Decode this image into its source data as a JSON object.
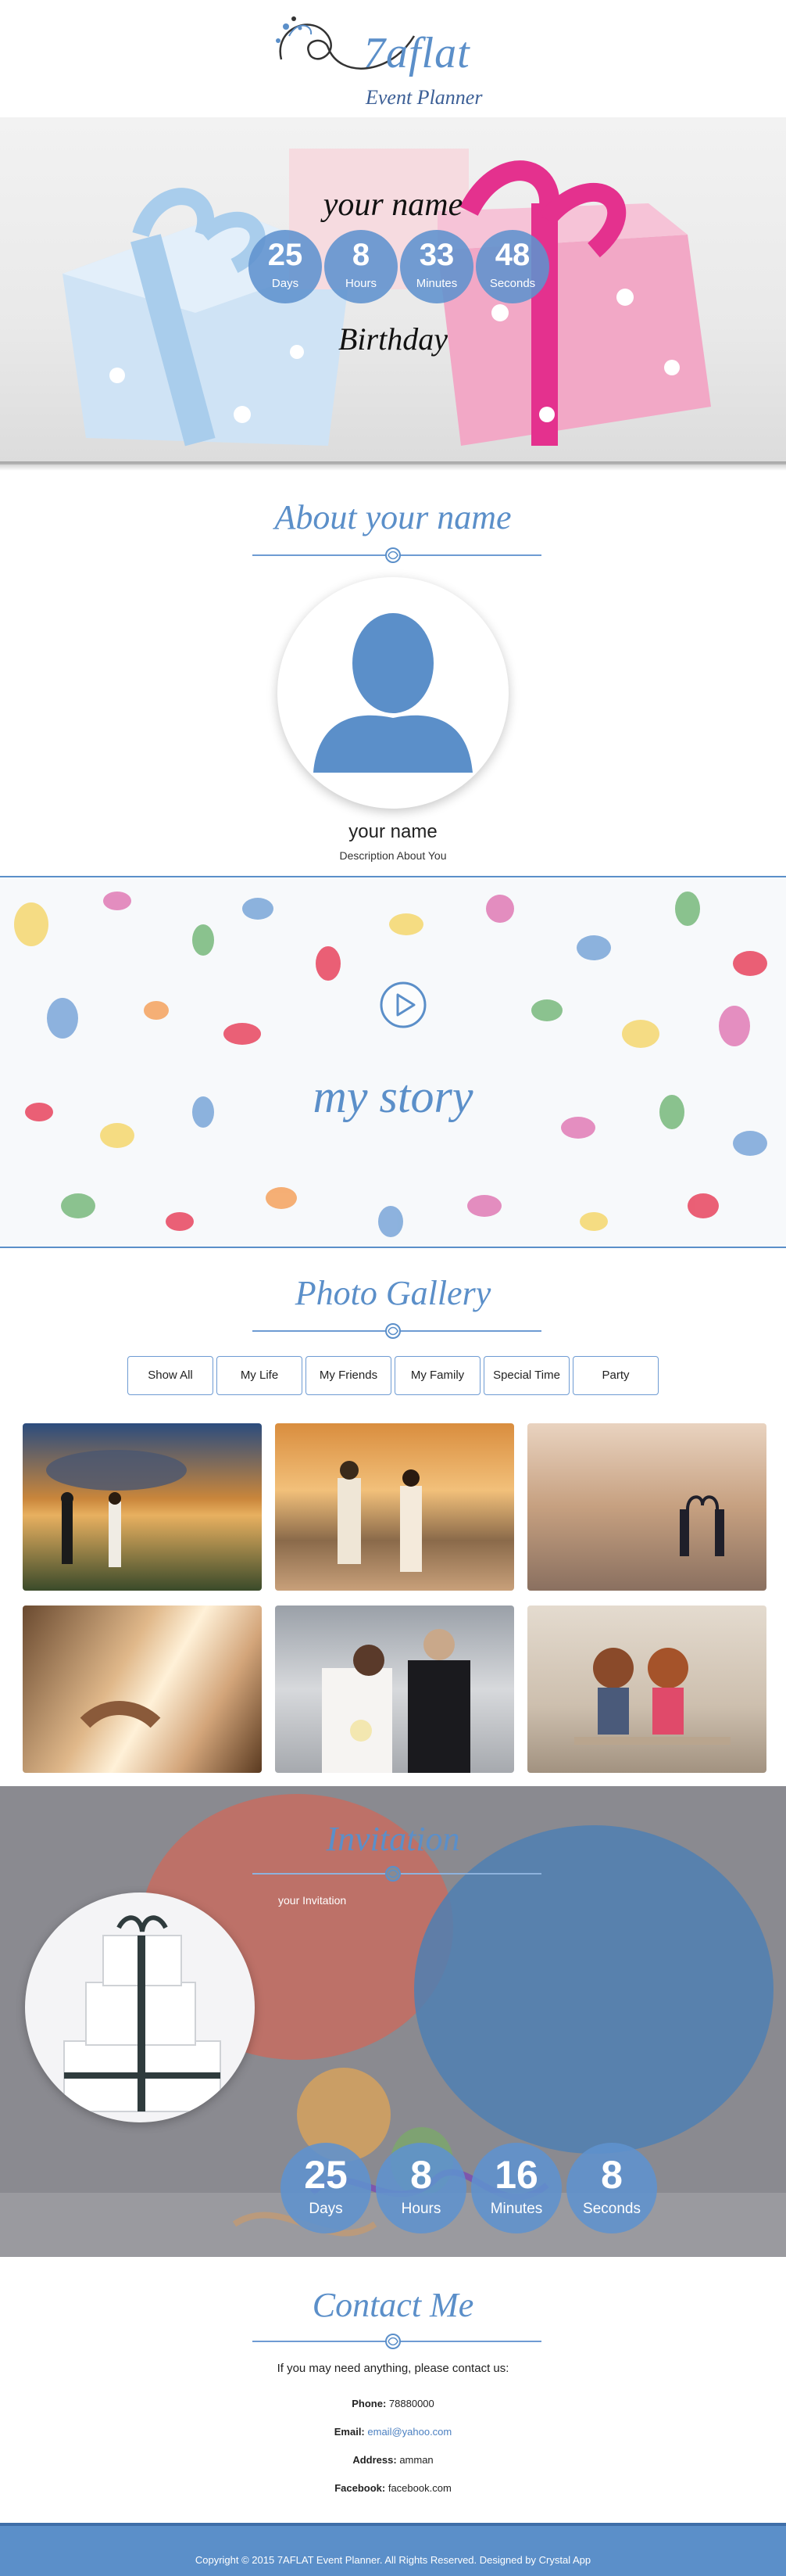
{
  "brand": {
    "logo_main": "7aflat",
    "logo_sub": "Event Planner"
  },
  "hero": {
    "name": "your name",
    "occasion": "Birthday",
    "countdown": [
      {
        "value": "25",
        "label": "Days"
      },
      {
        "value": "8",
        "label": "Hours"
      },
      {
        "value": "33",
        "label": "Minutes"
      },
      {
        "value": "48",
        "label": "Seconds"
      }
    ]
  },
  "about": {
    "title": "About your name",
    "name": "your name",
    "description": "Description About You"
  },
  "story": {
    "title": "my story"
  },
  "gallery": {
    "title": "Photo Gallery",
    "filters": [
      "Show All",
      "My Life",
      "My Friends",
      "My Family",
      "Special Time",
      "Party"
    ]
  },
  "invitation": {
    "title": "Invitation",
    "text": "your Invitation",
    "countdown": [
      {
        "value": "25",
        "label": "Days"
      },
      {
        "value": "8",
        "label": "Hours"
      },
      {
        "value": "16",
        "label": "Minutes"
      },
      {
        "value": "8",
        "label": "Seconds"
      }
    ]
  },
  "contact": {
    "title": "Contact Me",
    "intro": "If you may need anything, please contact us:",
    "phone_label": "Phone:",
    "phone": "78880000",
    "email_label": "Email:",
    "email": "email@yahoo.com",
    "address_label": "Address:",
    "address": "amman",
    "facebook_label": "Facebook:",
    "facebook": "facebook.com"
  },
  "footer": {
    "copyright": "Copyright © 2015 7AFLAT Event Planner. All Rights Reserved. Designed by Crystal App"
  },
  "colors": {
    "accent": "#5b8fc9",
    "accent_dark": "#3f6ea8"
  }
}
